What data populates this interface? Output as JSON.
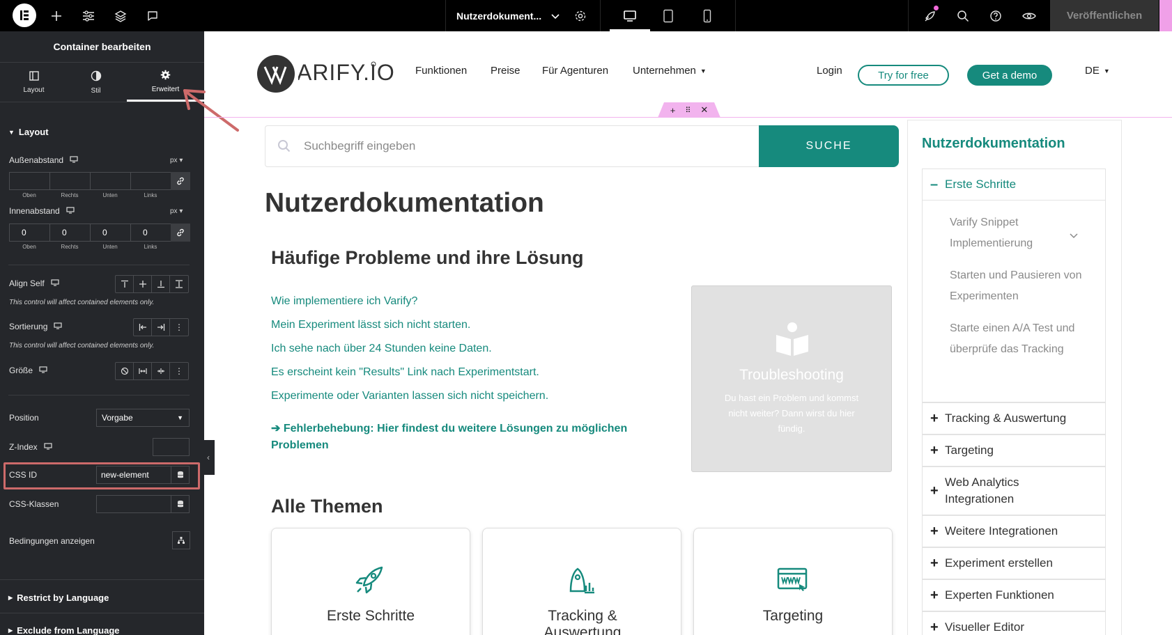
{
  "topbar": {
    "document_title": "Nutzerdokument...",
    "publish_label": "Veröffentlichen"
  },
  "sidebar": {
    "title": "Container bearbeiten",
    "tabs": [
      {
        "label": "Layout",
        "icon": "layout-icon",
        "active": false
      },
      {
        "label": "Stil",
        "icon": "contrast-icon",
        "active": false
      },
      {
        "label": "Erweitert",
        "icon": "gear-icon",
        "active": true
      }
    ],
    "section_layout": "Layout",
    "margin": {
      "label": "Außenabstand",
      "unit": "px",
      "values": [
        "",
        "",
        "",
        ""
      ],
      "sublabels": [
        "Oben",
        "Rechts",
        "Unten",
        "Links"
      ]
    },
    "padding": {
      "label": "Innenabstand",
      "unit": "px",
      "values": [
        "0",
        "0",
        "0",
        "0"
      ],
      "sublabels": [
        "Oben",
        "Rechts",
        "Unten",
        "Links"
      ]
    },
    "align_self": {
      "label": "Align Self",
      "note": "This control will affect contained elements only."
    },
    "order": {
      "label": "Sortierung",
      "note": "This control will affect contained elements only."
    },
    "size": {
      "label": "Größe"
    },
    "position": {
      "label": "Position",
      "value": "Vorgabe"
    },
    "z_index": {
      "label": "Z-Index",
      "value": ""
    },
    "css_id": {
      "label": "CSS ID",
      "value": "new-element"
    },
    "css_classes": {
      "label": "CSS-Klassen",
      "value": ""
    },
    "conditions": {
      "label": "Bedingungen anzeigen"
    },
    "section_restrict": "Restrict by Language",
    "section_exclude": "Exclude from Language"
  },
  "site": {
    "logo_text": "VARIFY.IO",
    "nav": [
      "Funktionen",
      "Preise",
      "Für Agenturen",
      "Unternehmen"
    ],
    "login": "Login",
    "try_free": "Try for free",
    "get_demo": "Get a demo",
    "lang": "DE",
    "brand_color": "#168a7d"
  },
  "main": {
    "search_placeholder": "Suchbegriff eingeben",
    "search_button": "SUCHE",
    "page_title": "Nutzerdokumentation",
    "faq_heading": "Häufige Probleme und ihre Lösung",
    "faq_items": [
      "Wie implementiere ich Varify?",
      "Mein Experiment lässt sich nicht starten.",
      "Ich sehe nach über 24 Stunden keine Daten.",
      "Es erscheint kein \"Results\" Link nach Experimentstart.",
      "Experimente oder Varianten lassen sich nicht speichern."
    ],
    "faq_more": "➔ Fehlerbehebung: Hier findest du weitere Lösungen zu möglichen Problemen",
    "trouble_card": {
      "title": "Troubleshooting",
      "text": "Du hast ein Problem und kommst nicht weiter? Dann wirst du hier fündig."
    },
    "topics_heading": "Alle Themen",
    "topics": [
      {
        "title": "Erste Schritte",
        "icon": "rocket-icon"
      },
      {
        "title": "Tracking & Auswertung",
        "icon": "chart-icon"
      },
      {
        "title": "Targeting",
        "icon": "www-icon"
      }
    ]
  },
  "right_sidebar": {
    "title": "Nutzerdokumentation",
    "open_section": "Erste Schritte",
    "sub_items": [
      "Varify Snippet Implementierung",
      "Starten und Pausieren von Experimenten",
      "Starte einen A/A Test und überprüfe das Tracking"
    ],
    "sections": [
      "Tracking & Auswertung",
      "Targeting",
      "Web Analytics Integrationen",
      "Weitere Integrationen",
      "Experiment erstellen",
      "Experten Funktionen",
      "Visueller Editor"
    ]
  }
}
